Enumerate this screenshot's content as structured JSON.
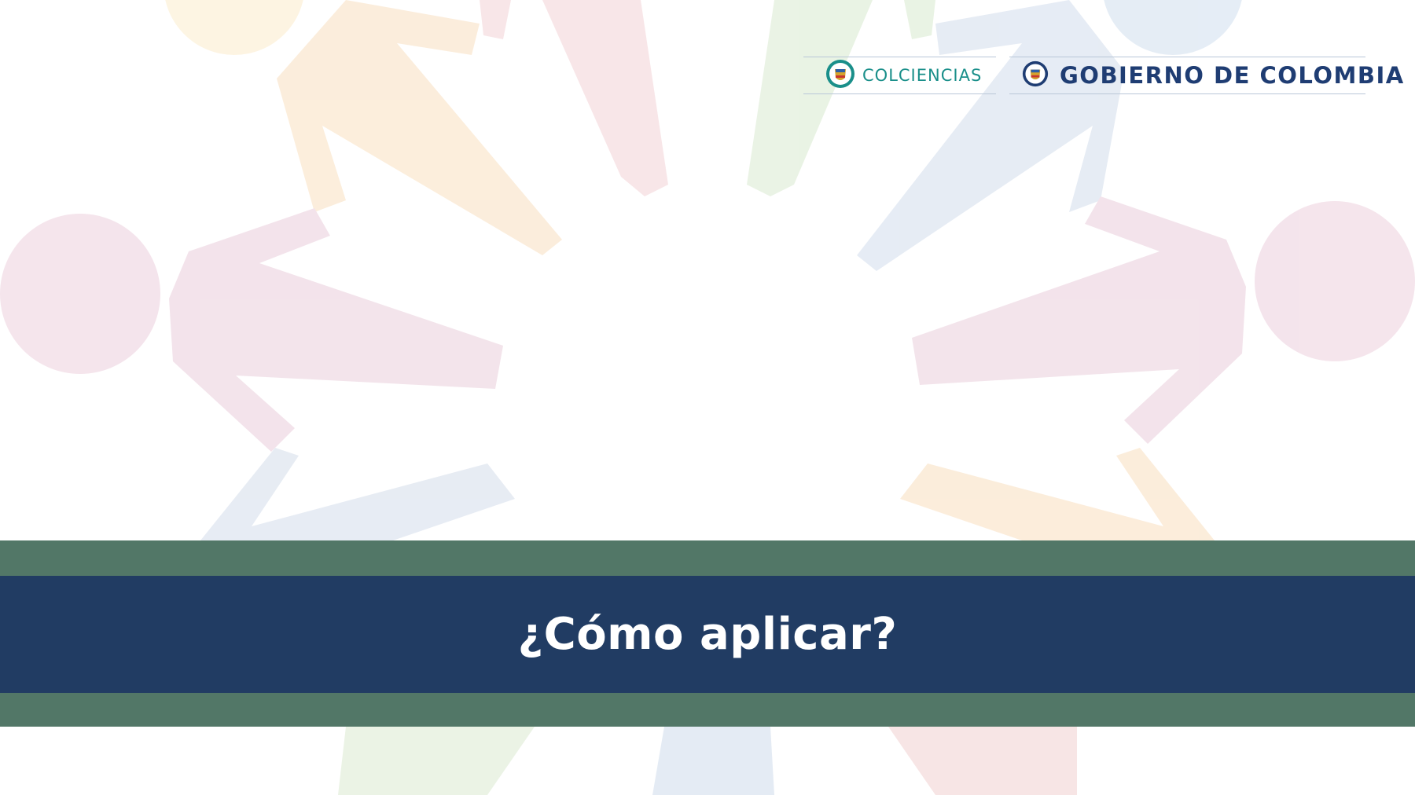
{
  "slide": {
    "title": "¿Cómo aplicar?"
  },
  "header": {
    "logos": [
      {
        "name": "colciencias-logo",
        "text": "COLCIENCIAS",
        "icon": "colombia-seal-icon",
        "color": "#1a8f8a"
      },
      {
        "name": "gobierno-logo",
        "text": "GOBIERNO DE COLOMBIA",
        "icon": "colombia-seal-icon",
        "color": "#1f3d73"
      }
    ]
  },
  "colors": {
    "band_green": "#527767",
    "band_navy": "#213c63",
    "title_text": "#ffffff",
    "figures": [
      "#f2dce6",
      "#fbe8d2",
      "#dfe7f2",
      "#e5f0dd",
      "#f6dede",
      "#f3e2ea"
    ]
  },
  "background": {
    "motif": "circle-of-people-figures-holding-hands"
  }
}
